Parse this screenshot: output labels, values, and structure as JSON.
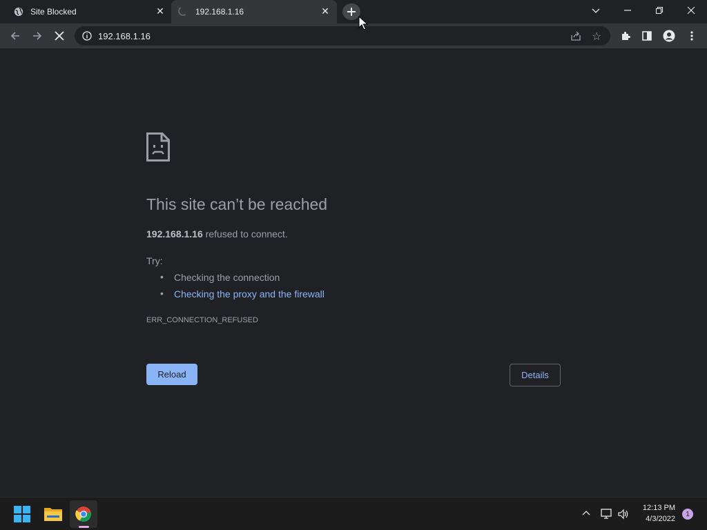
{
  "tabs": [
    {
      "title": "Site Blocked",
      "favicon": "globe-icon"
    },
    {
      "title": "192.168.1.16",
      "favicon": "loading-spinner"
    }
  ],
  "toolbar": {
    "url": "192.168.1.16"
  },
  "error": {
    "title": "This site can’t be reached",
    "host": "192.168.1.16",
    "message": " refused to connect.",
    "try_label": "Try:",
    "suggestions": [
      "Checking the connection",
      "Checking the proxy and the firewall"
    ],
    "code": "ERR_CONNECTION_REFUSED",
    "reload_label": "Reload",
    "details_label": "Details"
  },
  "taskbar": {
    "time": "12:13 PM",
    "date": "4/3/2022",
    "notification_count": "1"
  },
  "colors": {
    "background": "#202124",
    "toolbar": "#35363a",
    "link": "#8ab4f8",
    "text_muted": "#9aa0a6"
  }
}
